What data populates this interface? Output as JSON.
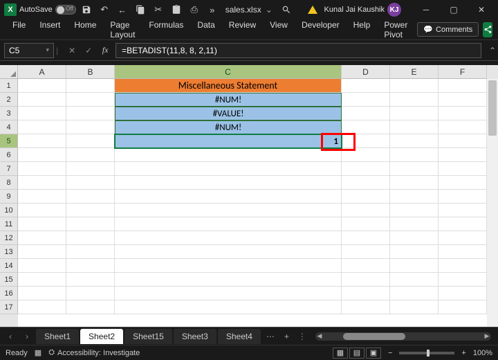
{
  "titlebar": {
    "autosave_label": "AutoSave",
    "autosave_state": "Off",
    "filename": "sales.xlsx",
    "user_name": "Kunal Jai Kaushik",
    "user_initials": "KJ"
  },
  "menubar": [
    "File",
    "Insert",
    "Home",
    "Page Layout",
    "Formulas",
    "Data",
    "Review",
    "View",
    "Developer",
    "Help",
    "Power Pivot"
  ],
  "comments_label": "Comments",
  "namebox": "C5",
  "formula": "=BETADIST(11,8, 8, 2,11)",
  "columns": [
    "A",
    "B",
    "C",
    "D",
    "E",
    "F"
  ],
  "rows": 17,
  "selected_col": "C",
  "selected_row": 5,
  "cells": {
    "C1": "Miscellaneous Statement",
    "C2": "#NUM!",
    "C3": "#VALUE!",
    "C4": "#NUM!",
    "C5": "1"
  },
  "tabs": [
    "Sheet1",
    "Sheet2",
    "Sheet15",
    "Sheet3",
    "Sheet4"
  ],
  "active_tab": "Sheet2",
  "statusbar": {
    "ready": "Ready",
    "accessibility": "Accessibility: Investigate",
    "zoom": "100%"
  },
  "chart_data": {
    "type": "table",
    "title": "Miscellaneous Statement",
    "values": [
      "#NUM!",
      "#VALUE!",
      "#NUM!",
      1
    ],
    "formula_C5": "=BETADIST(11,8, 8, 2,11)"
  }
}
